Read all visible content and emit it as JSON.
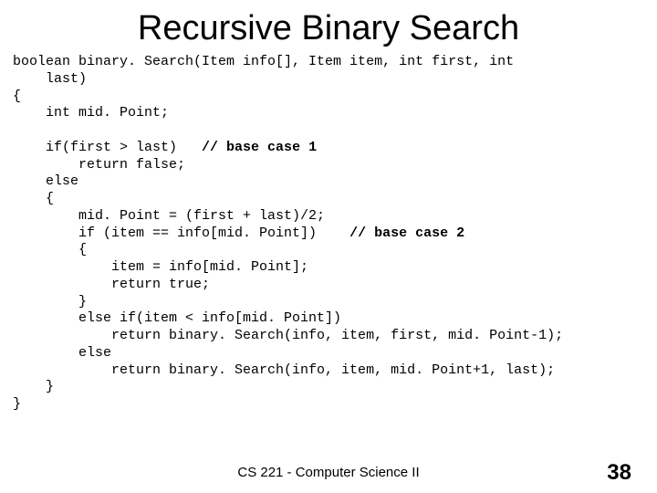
{
  "title": "Recursive Binary Search",
  "code": {
    "l1a": "boolean binary. Search(Item info[], Item item, int first, int",
    "l1b": "    last)",
    "l2": "{",
    "l3": "    int mid. Point;",
    "l4": "",
    "l5a": "    if(first > last)   ",
    "l5b": "// base case 1",
    "l6": "        return false;",
    "l7": "    else",
    "l8": "    {",
    "l9": "        mid. Point = (first + last)/2;",
    "l10a": "        if (item == info[mid. Point])    ",
    "l10b": "// base case 2",
    "l11": "        {",
    "l12": "            item = info[mid. Point];",
    "l13": "            return true;",
    "l14": "        }",
    "l15": "        else if(item < info[mid. Point])",
    "l16": "            return binary. Search(info, item, first, mid. Point-1);",
    "l17": "        else",
    "l18": "            return binary. Search(info, item, mid. Point+1, last);",
    "l19": "    }",
    "l20": "}"
  },
  "footer": "CS 221 - Computer Science II",
  "page": "38"
}
